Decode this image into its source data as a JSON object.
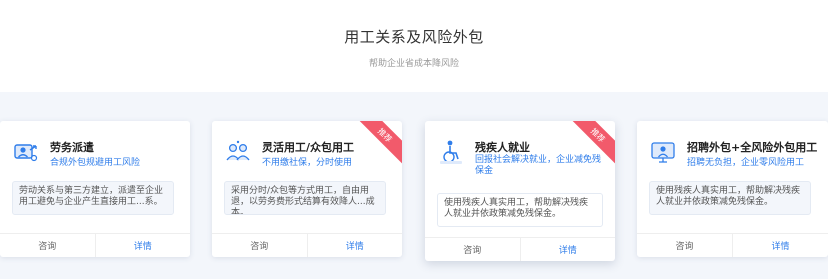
{
  "header": {
    "title": "用工关系及风险外包",
    "subtitle": "帮助企业省成本降风险"
  },
  "cards": [
    {
      "title": "劳务派遣",
      "subtitle": "合规外包规避用工风险",
      "desc": "劳动关系与第三方建立，派遣至企业用工避免与企业产生直接用工...系。",
      "consult": "咨询",
      "details": "详情",
      "icon": "dispatch-icon",
      "badge": ""
    },
    {
      "title": "灵活用工/众包用工",
      "subtitle": "不用缴社保，分时使用",
      "desc": "采用分时/众包等方式用工，自由用退，以劳务费形式结算有效降人...成本。",
      "consult": "咨询",
      "details": "详情",
      "icon": "team-icon",
      "badge": "推荐"
    },
    {
      "title": "残疾人就业",
      "subtitle": "回报社会解决就业，企业减免残保金",
      "desc": "使用残疾人真实用工，帮助解决残疾人就业并依政策减免残保金。",
      "consult": "咨询",
      "details": "详情",
      "icon": "wheelchair-icon",
      "badge": "推荐"
    },
    {
      "title": "招聘外包+全风险外包用工",
      "subtitle": "招聘无负担，企业零风险用工",
      "desc": "使用残疾人真实用工，帮助解决残疾人就业并依政策减免残保金。",
      "consult": "咨询",
      "details": "详情",
      "icon": "recruit-icon",
      "badge": ""
    }
  ],
  "colors": {
    "accent": "#2f7dea",
    "badge": "#f25a6b",
    "band": "#f3f6fb"
  }
}
